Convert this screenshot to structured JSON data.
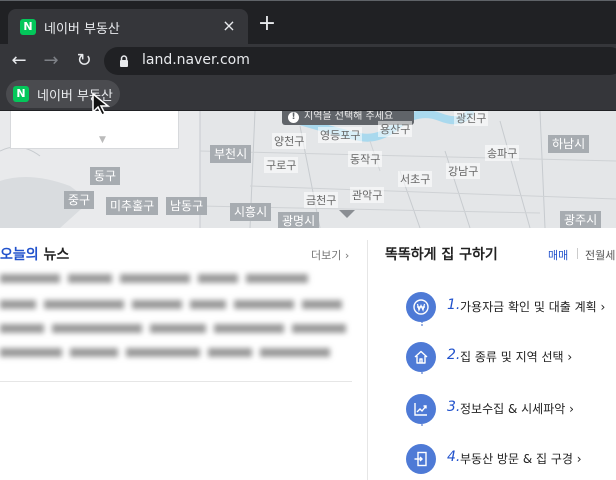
{
  "browser": {
    "tab_title": "네이버 부동산",
    "tab_favicon": "N",
    "close_glyph": "×",
    "newtab_glyph": "+",
    "url": "land.naver.com",
    "back_glyph": "←",
    "forward_glyph": "→",
    "reload_glyph": "↻",
    "bookmark_title": "네이버 부동산",
    "bookmark_favicon": "N"
  },
  "map": {
    "tooltip": "지역을 선택해 주세요",
    "tooltip_icon": "!",
    "box_labels": {
      "bucheon": "부천시",
      "donggu": "동구",
      "junggu": "중구",
      "michuhol": "미추홀구",
      "namdong": "남동구",
      "siheung": "시흥시",
      "gwangmyeong": "광명시",
      "hanam": "하남시",
      "gwangju": "광주시"
    },
    "district_labels": {
      "yangcheon": "양천구",
      "guro": "구로구",
      "yeongdeungpo": "영등포구",
      "dongjak": "동작구",
      "geumcheon": "금천구",
      "gwanak": "관악구",
      "seocho": "서초구",
      "gangnam": "강남구",
      "songpa": "송파구",
      "yongsan": "용산구",
      "gwangjin": "광진구"
    }
  },
  "news": {
    "title_highlight": "오늘의",
    "title_rest": " 뉴스",
    "more": "더보기 ›"
  },
  "house": {
    "title": "똑똑하게 집 구하기",
    "tab_active": "매매",
    "tab_other": "전월세",
    "steps": [
      {
        "num": "1.",
        "label": "가용자금 확인 및 대출 계획 ›",
        "icon": "won-icon"
      },
      {
        "num": "2.",
        "label": "집 종류 및 지역 선택 ›",
        "icon": "house-icon"
      },
      {
        "num": "3.",
        "label": "정보수집 & 시세파악 ›",
        "icon": "trend-chart-icon"
      },
      {
        "num": "4.",
        "label": "부동산 방문 & 집 구경 ›",
        "icon": "door-enter-icon"
      }
    ]
  },
  "colors": {
    "naver_green": "#03c75a",
    "accent_blue": "#2152cc",
    "step_circle": "#4e7ad6",
    "river": "#a9d9ee"
  }
}
